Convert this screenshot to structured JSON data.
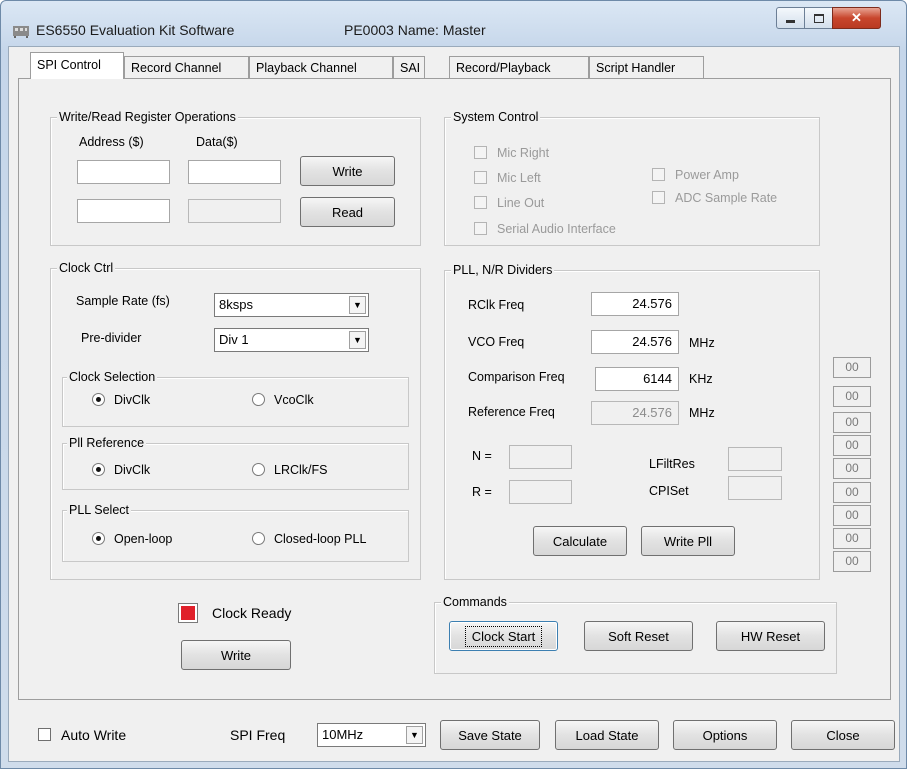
{
  "window": {
    "title": "ES6550 Evaluation Kit Software",
    "subtitle": "PE0003 Name: Master",
    "icon": "app-icon"
  },
  "tabs": [
    "SPI Control",
    "Record Channel",
    "Playback Channel",
    "SAI",
    "Record/Playback",
    "Script Handler"
  ],
  "register": {
    "title": "Write/Read Register Operations",
    "address_label": "Address ($)",
    "data_label": "Data($)",
    "write_label": "Write",
    "read_label": "Read"
  },
  "system_control": {
    "title": "System Control",
    "items": [
      "Mic Right",
      "Mic Left",
      "Line Out",
      "Serial Audio Interface",
      "Power Amp",
      "ADC Sample Rate"
    ]
  },
  "clock_ctrl": {
    "title": "Clock Ctrl",
    "sample_rate_label": "Sample Rate (fs)",
    "sample_rate_value": "8ksps",
    "prediv_label": "Pre-divider",
    "prediv_value": "Div 1",
    "clock_selection": {
      "title": "Clock Selection",
      "opt1": "DivClk",
      "opt2": "VcoClk"
    },
    "pll_reference": {
      "title": "Pll Reference",
      "opt1": "DivClk",
      "opt2": "LRClk/FS"
    },
    "pll_select": {
      "title": "PLL Select",
      "opt1": "Open-loop",
      "opt2": "Closed-loop PLL"
    }
  },
  "pll": {
    "title": "PLL, N/R Dividers",
    "rclk_label": "RClk Freq",
    "rclk_value": "24.576",
    "vco_label": "VCO Freq",
    "vco_value": "24.576",
    "vco_unit": "MHz",
    "comp_label": "Comparison Freq",
    "comp_value": "6144",
    "comp_unit": "KHz",
    "ref_label": "Reference Freq",
    "ref_value": "24.576",
    "ref_unit": "MHz",
    "n_label": "N =",
    "r_label": "R =",
    "lfiltres_label": "LFiltRes",
    "cpiset_label": "CPISet",
    "calculate_label": "Calculate",
    "write_pll_label": "Write Pll"
  },
  "side_values": [
    "00",
    "00",
    "00",
    "00",
    "00",
    "00",
    "00",
    "00",
    "00",
    "00"
  ],
  "clock_ready": {
    "label": "Clock Ready",
    "write_label": "Write",
    "indicator_color": "#e0202a"
  },
  "commands": {
    "title": "Commands",
    "clock_start": "Clock Start",
    "soft_reset": "Soft Reset",
    "hw_reset": "HW Reset"
  },
  "footer": {
    "auto_write": "Auto Write",
    "spi_freq_label": "SPI Freq",
    "spi_freq_value": "10MHz",
    "save_state": "Save State",
    "load_state": "Load State",
    "options": "Options",
    "close": "Close"
  }
}
